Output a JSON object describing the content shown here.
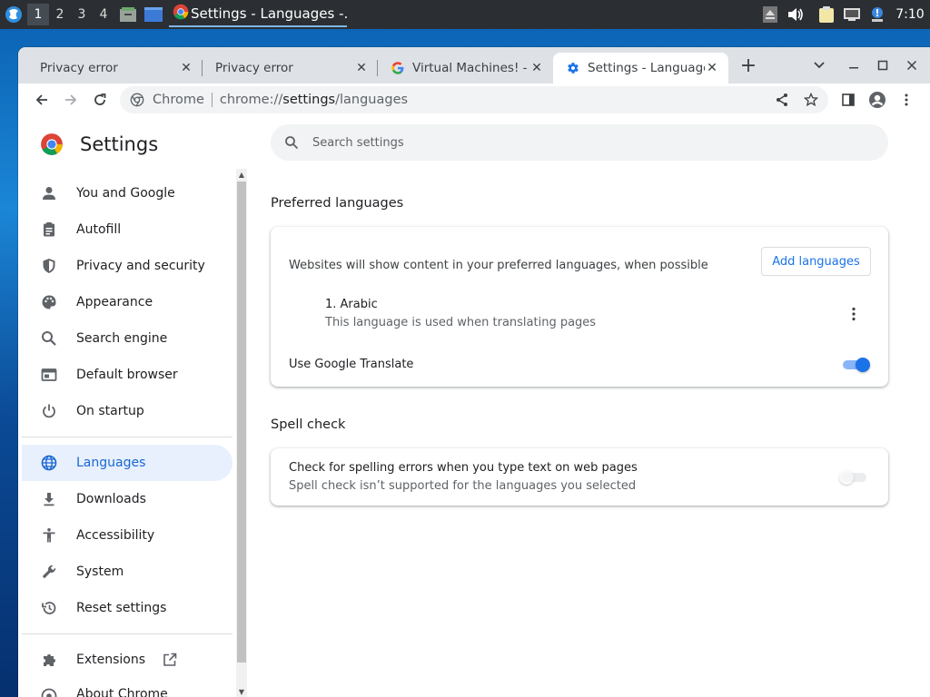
{
  "taskbar": {
    "workspaces": [
      "1",
      "2",
      "3",
      "4"
    ],
    "task_title": "Settings - Languages -...",
    "clock": "7:10"
  },
  "browser": {
    "tabs": [
      {
        "title": "Privacy error"
      },
      {
        "title": "Privacy error"
      },
      {
        "title": "Virtual Machines! -"
      },
      {
        "title": "Settings - Languages"
      }
    ],
    "omnibox": {
      "chip": "Chrome",
      "url_prefix": "chrome://",
      "url_host": "settings",
      "url_path": "/languages"
    }
  },
  "settings": {
    "title": "Settings",
    "search_placeholder": "Search settings",
    "nav": [
      {
        "label": "You and Google"
      },
      {
        "label": "Autofill"
      },
      {
        "label": "Privacy and security"
      },
      {
        "label": "Appearance"
      },
      {
        "label": "Search engine"
      },
      {
        "label": "Default browser"
      },
      {
        "label": "On startup"
      },
      {
        "label": "Languages"
      },
      {
        "label": "Downloads"
      },
      {
        "label": "Accessibility"
      },
      {
        "label": "System"
      },
      {
        "label": "Reset settings"
      },
      {
        "label": "Extensions"
      },
      {
        "label": "About Chrome"
      }
    ],
    "preferred": {
      "heading": "Preferred languages",
      "description": "Websites will show content in your preferred languages, when possible",
      "add_button": "Add languages",
      "language_name": "1. Arabic",
      "language_note": "This language is used when translating pages",
      "translate_label": "Use Google Translate",
      "translate_on": true
    },
    "spell": {
      "heading": "Spell check",
      "label": "Check for spelling errors when you type text on web pages",
      "note": "Spell check isn’t supported for the languages you selected",
      "enabled": false
    }
  },
  "colors": {
    "accent": "#1a73e8",
    "nav_active_bg": "#e8f0fe",
    "nav_active_text": "#1967d2"
  }
}
